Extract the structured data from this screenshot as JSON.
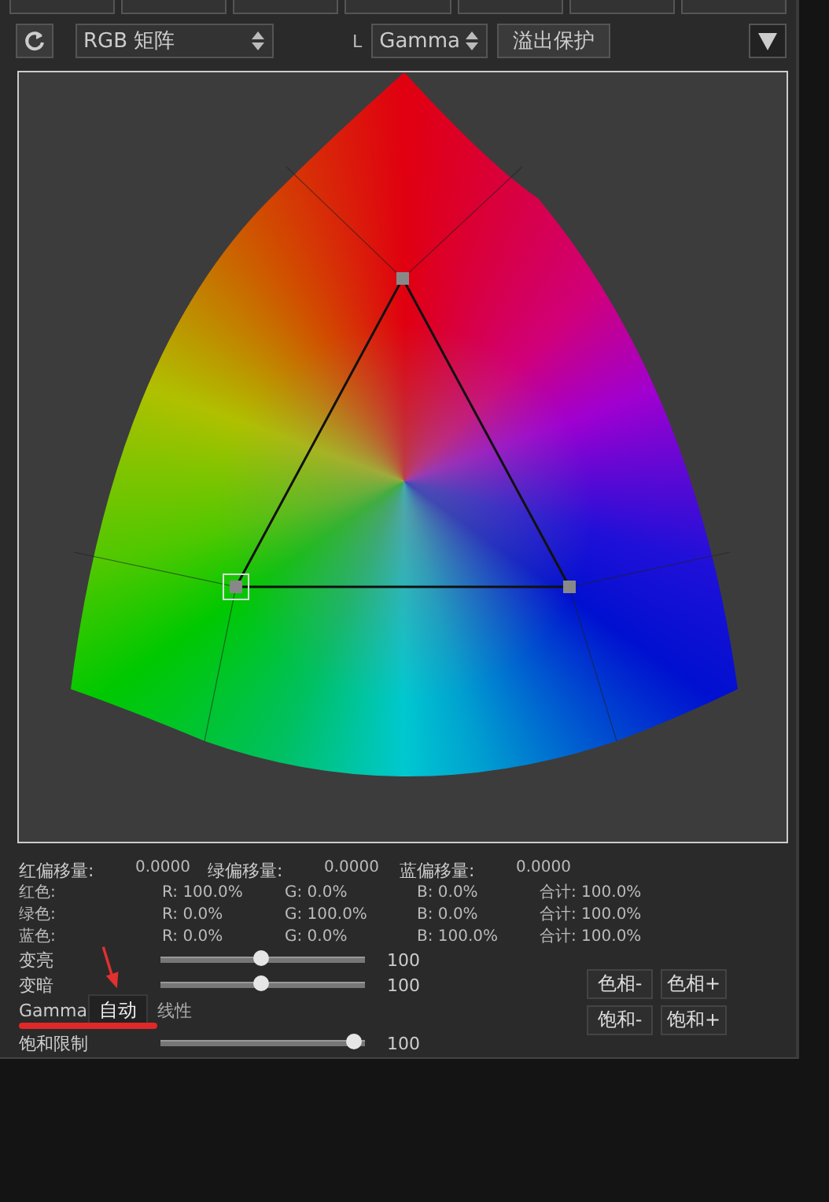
{
  "toolbar": {
    "matrix_select": "RGB 矩阵",
    "l_label": "L",
    "gamma_select": "Gamma",
    "overflow_button": "溢出保护"
  },
  "offsets": [
    {
      "label": "红偏移量:",
      "value": "0.0000"
    },
    {
      "label": "绿偏移量:",
      "value": "0.0000"
    },
    {
      "label": "蓝偏移量:",
      "value": "0.0000"
    }
  ],
  "matrix": [
    {
      "label": "红色:",
      "r": "R: 100.0%",
      "g": "G: 0.0%",
      "b": "B: 0.0%",
      "total": "合计: 100.0%"
    },
    {
      "label": "绿色:",
      "r": "R: 0.0%",
      "g": "G: 100.0%",
      "b": "B: 0.0%",
      "total": "合计: 100.0%"
    },
    {
      "label": "蓝色:",
      "r": "R: 0.0%",
      "g": "G: 0.0%",
      "b": "B: 100.0%",
      "total": "合计: 100.0%"
    }
  ],
  "sliders": [
    {
      "label": "变亮",
      "level": 0.49,
      "reading": "100"
    },
    {
      "label": "变暗",
      "level": 0.49,
      "reading": "100"
    }
  ],
  "gamma": {
    "label": "Gamma",
    "options": [
      {
        "label": "自动",
        "selected": true
      },
      {
        "label": "线性",
        "selected": false
      }
    ]
  },
  "saturation": {
    "label": "饱和限制",
    "level": 0.98,
    "reading": "100"
  },
  "buttons": [
    "色相-",
    "色相+",
    "饱和-",
    "饱和+"
  ]
}
